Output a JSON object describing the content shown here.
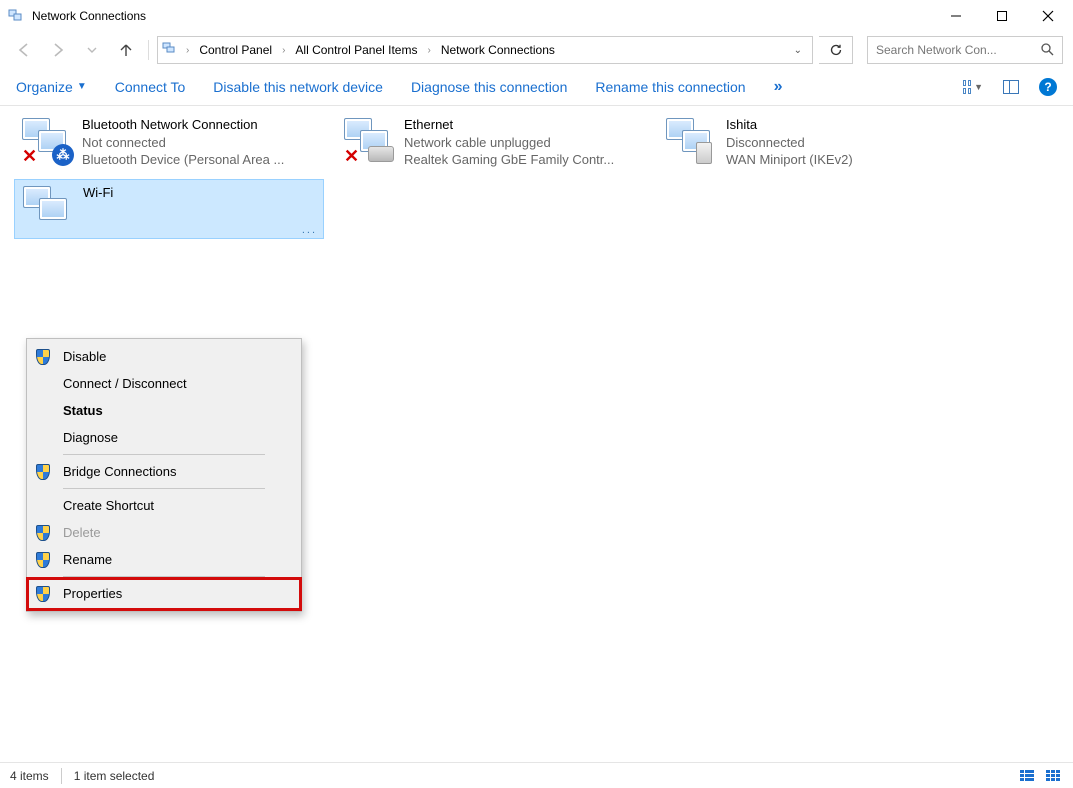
{
  "window": {
    "title": "Network Connections"
  },
  "breadcrumb": {
    "items": [
      "Control Panel",
      "All Control Panel Items",
      "Network Connections"
    ]
  },
  "search": {
    "placeholder": "Search Network Con..."
  },
  "commands": {
    "organize": "Organize",
    "connect_to": "Connect To",
    "disable": "Disable this network device",
    "diagnose": "Diagnose this connection",
    "rename": "Rename this connection",
    "help": "?"
  },
  "connections": [
    {
      "name": "Bluetooth Network Connection",
      "status": "Not connected",
      "device": "Bluetooth Device (Personal Area ...",
      "icon_type": "bluetooth",
      "show_x": true
    },
    {
      "name": "Ethernet",
      "status": "Network cable unplugged",
      "device": "Realtek Gaming GbE Family Contr...",
      "icon_type": "ethernet",
      "show_x": true
    },
    {
      "name": "Ishita",
      "status": "Disconnected",
      "device": "WAN Miniport (IKEv2)",
      "icon_type": "vpn",
      "show_x": false
    }
  ],
  "selected_connection": {
    "name": "Wi-Fi"
  },
  "context_menu": {
    "items": [
      {
        "label": "Disable",
        "shield": true,
        "bold": false,
        "disabled": false
      },
      {
        "label": "Connect / Disconnect",
        "shield": false,
        "bold": false,
        "disabled": false
      },
      {
        "label": "Status",
        "shield": false,
        "bold": true,
        "disabled": false
      },
      {
        "label": "Diagnose",
        "shield": false,
        "bold": false,
        "disabled": false
      },
      {
        "sep": true
      },
      {
        "label": "Bridge Connections",
        "shield": true,
        "bold": false,
        "disabled": false
      },
      {
        "sep": true
      },
      {
        "label": "Create Shortcut",
        "shield": false,
        "bold": false,
        "disabled": false
      },
      {
        "label": "Delete",
        "shield": true,
        "bold": false,
        "disabled": true
      },
      {
        "label": "Rename",
        "shield": true,
        "bold": false,
        "disabled": false
      },
      {
        "sep": true
      },
      {
        "label": "Properties",
        "shield": true,
        "bold": false,
        "disabled": false,
        "highlight": true
      }
    ]
  },
  "statusbar": {
    "count": "4 items",
    "selected": "1 item selected"
  }
}
